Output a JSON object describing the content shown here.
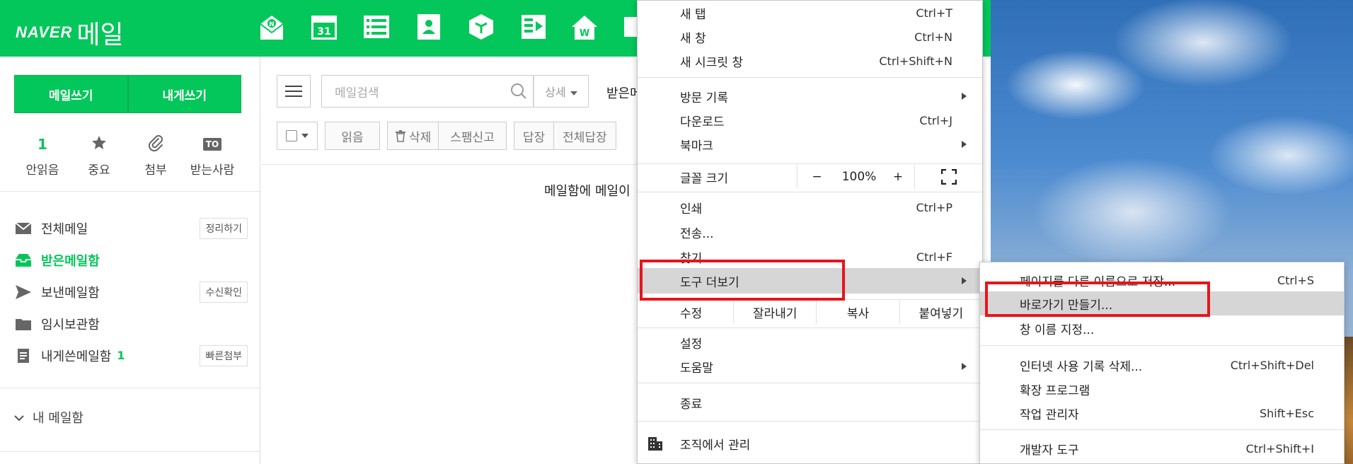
{
  "header": {
    "logo_brand": "NAVER",
    "logo_product": "메일",
    "apps": [
      "mail-app-icon",
      "calendar-icon",
      "list-icon",
      "contacts-icon",
      "cube-icon",
      "board-icon",
      "home-icon"
    ],
    "calendar_day": "31"
  },
  "sidebar": {
    "write_button": "메일쓰기",
    "write_to_self_button": "내게쓰기",
    "quick": [
      {
        "label": "안읽음",
        "value": "1"
      },
      {
        "label": "중요"
      },
      {
        "label": "첨부"
      },
      {
        "label": "받는사람",
        "badge": "TO"
      }
    ],
    "folders": [
      {
        "label": "전체메일",
        "button": "정리하기"
      },
      {
        "label": "받은메일함"
      },
      {
        "label": "보낸메일함",
        "button": "수신확인"
      },
      {
        "label": "임시보관함"
      },
      {
        "label": "내게쓴메일함",
        "count": "1",
        "button": "빠른첨부"
      }
    ],
    "my_mailbox": "내 메일함"
  },
  "main": {
    "search_placeholder": "메일검색",
    "detail_label": "상세",
    "inbox_title": "받은메",
    "actions": {
      "read": "읽음",
      "delete": "삭제",
      "spam": "스팸신고",
      "reply": "답장",
      "reply_all": "전체답장"
    },
    "empty_message": "메일함에 메일이"
  },
  "menu": {
    "new_tab": {
      "label": "새 탭",
      "shortcut": "Ctrl+T"
    },
    "new_window": {
      "label": "새 창",
      "shortcut": "Ctrl+N"
    },
    "new_incognito": {
      "label": "새 시크릿 창",
      "shortcut": "Ctrl+Shift+N"
    },
    "history": {
      "label": "방문 기록"
    },
    "downloads": {
      "label": "다운로드",
      "shortcut": "Ctrl+J"
    },
    "bookmarks": {
      "label": "북마크"
    },
    "zoom": {
      "label": "글꼴 크기",
      "minus": "−",
      "value": "100%",
      "plus": "+"
    },
    "print": {
      "label": "인쇄",
      "shortcut": "Ctrl+P"
    },
    "cast": {
      "label": "전송..."
    },
    "find": {
      "label": "찾기",
      "shortcut": "Ctrl+F"
    },
    "more_tools": {
      "label": "도구 더보기"
    },
    "edit": {
      "label": "수정",
      "cut": "잘라내기",
      "copy": "복사",
      "paste": "붙여넣기"
    },
    "settings": {
      "label": "설정"
    },
    "help": {
      "label": "도움말"
    },
    "exit": {
      "label": "종료"
    },
    "managed": {
      "label": "조직에서 관리"
    }
  },
  "submenu": {
    "save_as": {
      "label": "페이지를 다른 이름으로 저장...",
      "shortcut": "Ctrl+S"
    },
    "create_shortcut": {
      "label": "바로가기 만들기..."
    },
    "name_window": {
      "label": "창 이름 지정..."
    },
    "clear_data": {
      "label": "인터넷 사용 기록 삭제...",
      "shortcut": "Ctrl+Shift+Del"
    },
    "extensions": {
      "label": "확장 프로그램"
    },
    "task_manager": {
      "label": "작업 관리자",
      "shortcut": "Shift+Esc"
    },
    "dev_tools": {
      "label": "개발자 도구",
      "shortcut": "Ctrl+Shift+I"
    }
  },
  "colors": {
    "naver_green": "#03c75a",
    "highlight_red": "#e8141b",
    "menu_hover": "#d6d6d6"
  }
}
